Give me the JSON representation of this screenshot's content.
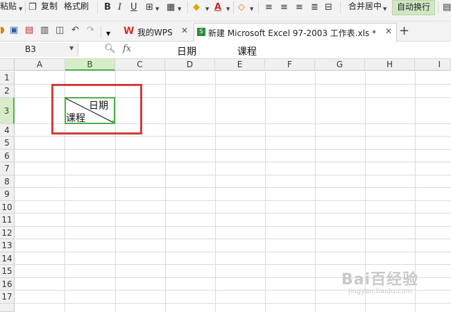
{
  "ribbon": {
    "paste_label": "粘贴",
    "copy_label": "复制",
    "format_painter_label": "格式刷",
    "bold_label": "B",
    "italic_label": "I",
    "underline_label": "U",
    "merge_center_label": "合并居中",
    "auto_wrap_label": "自动换行"
  },
  "tabs": [
    {
      "label": "我的WPS",
      "active": false
    },
    {
      "label": "新建 Microsoft Excel 97-2003 工作表.xls *",
      "active": true
    }
  ],
  "formula_bar": {
    "name_box": "B3",
    "fx_label": "fx",
    "content_part1": "日期",
    "content_part2": "课程"
  },
  "columns": [
    "A",
    "B",
    "C",
    "D",
    "E",
    "F",
    "G",
    "H",
    "I"
  ],
  "rows": [
    "1",
    "2",
    "3",
    "4",
    "5",
    "6",
    "7",
    "8",
    "9",
    "10",
    "11",
    "12",
    "13",
    "14",
    "15",
    "16",
    "17"
  ],
  "selected_cell": {
    "ref": "B3",
    "top_right_text": "日期",
    "bottom_left_text": "课程"
  },
  "watermark": {
    "line1": "Bai百经验",
    "line2": "jingyan.baidu.com"
  },
  "colors": {
    "selection_green": "#4caf50",
    "highlight_red": "#d33b3b",
    "header_bg": "#f0f0f0"
  }
}
